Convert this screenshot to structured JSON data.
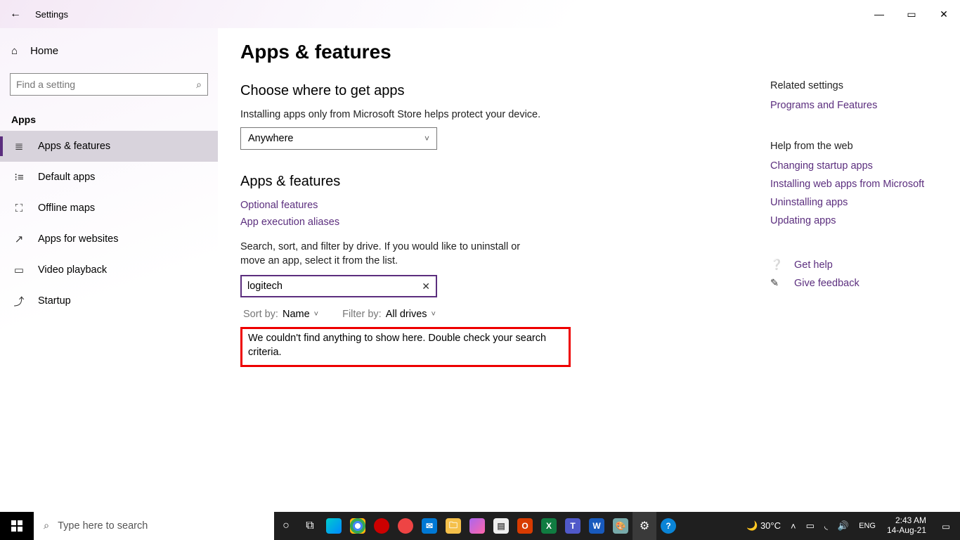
{
  "window": {
    "title": "Settings",
    "minimize_glyph": "—",
    "maximize_glyph": "▭",
    "close_glyph": "✕",
    "back_glyph": "←"
  },
  "sidebar": {
    "home_label": "Home",
    "search_placeholder": "Find a setting",
    "group_label": "Apps",
    "items": [
      {
        "icon": "list-icon",
        "glyph": "≣",
        "label": "Apps & features",
        "selected": true
      },
      {
        "icon": "defaults-icon",
        "glyph": "⁝≡",
        "label": "Default apps"
      },
      {
        "icon": "map-icon",
        "glyph": "⛶",
        "label": "Offline maps"
      },
      {
        "icon": "link-icon",
        "glyph": "↗",
        "label": "Apps for websites"
      },
      {
        "icon": "video-icon",
        "glyph": "▭",
        "label": "Video playback"
      },
      {
        "icon": "startup-icon",
        "glyph": "⤴",
        "label": "Startup"
      }
    ]
  },
  "main": {
    "page_title": "Apps & features",
    "choose": {
      "title": "Choose where to get apps",
      "helper": "Installing apps only from Microsoft Store helps protect your device.",
      "value": "Anywhere"
    },
    "af": {
      "title": "Apps & features",
      "link_optional": "Optional features",
      "link_aliases": "App execution aliases",
      "helper": "Search, sort, and filter by drive. If you would like to uninstall or move an app, select it from the list.",
      "search_value": "logitech",
      "sort_label": "Sort by:",
      "sort_value": "Name",
      "filter_label": "Filter by:",
      "filter_value": "All drives",
      "no_results": "We couldn't find anything to show here. Double check your search criteria."
    }
  },
  "rail": {
    "related_title": "Related settings",
    "related_link": "Programs and Features",
    "help_title": "Help from the web",
    "help_links": [
      "Changing startup apps",
      "Installing web apps from Microsoft",
      "Uninstalling apps",
      "Updating apps"
    ],
    "get_help": "Get help",
    "feedback": "Give feedback"
  },
  "taskbar": {
    "search_placeholder": "Type here to search",
    "weather_temp": "30°C",
    "clock_time": "2:43 AM",
    "clock_date": "14-Aug-21"
  }
}
